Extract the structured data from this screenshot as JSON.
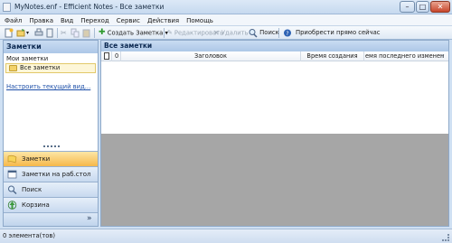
{
  "window": {
    "title": "MyNotes.enf - Efficient Notes - Все заметки",
    "minimize_glyph": "–",
    "maximize_glyph": "□",
    "close_glyph": "✕"
  },
  "menu": {
    "items": [
      "Файл",
      "Правка",
      "Вид",
      "Переход",
      "Сервис",
      "Действия",
      "Помощь"
    ]
  },
  "toolbar": {
    "create_label": "Создать Заметка",
    "edit_label": "Редактировать",
    "delete_label": "Удалить",
    "search_label": "Поиск",
    "buy_label": "Приобрести прямо сейчас"
  },
  "left_pane": {
    "header": "Заметки",
    "group_label": "Мои заметки",
    "all_notes_label": "Все заметки",
    "customize_link": "Настроить текущий вид...",
    "nav": [
      {
        "label": "Заметки",
        "icon": "notes-icon",
        "active": true
      },
      {
        "label": "Заметки на раб.стол",
        "icon": "desktop-notes-icon",
        "active": false
      },
      {
        "label": "Поиск",
        "icon": "search-icon",
        "active": false
      },
      {
        "label": "Корзина",
        "icon": "recycle-bin-icon",
        "active": false
      }
    ],
    "overflow_glyph": "»"
  },
  "main_pane": {
    "header": "Все заметки",
    "columns": {
      "attachment_glyph": "0",
      "title": "Заголовок",
      "created": "Время создания",
      "modified": "емя последнего изменен"
    }
  },
  "status": {
    "text": "0 элемента(тов)"
  },
  "colors": {
    "pane_header": "#b9cfec",
    "active_nav": "#f8c85e",
    "preview_bg": "#a6a6a6",
    "link": "#1d4fa8"
  }
}
